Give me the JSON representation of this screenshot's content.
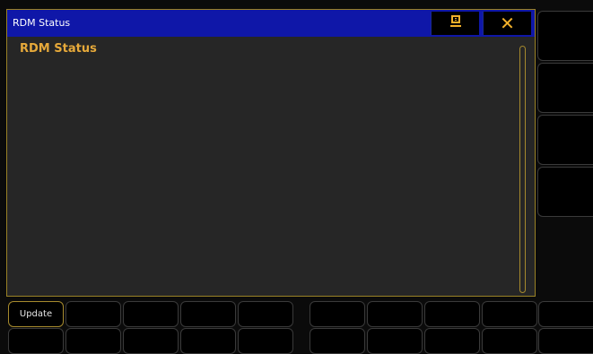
{
  "window": {
    "title": "RDM Status",
    "content_title": "RDM Status"
  },
  "buttons": {
    "update_label": "Update"
  }
}
